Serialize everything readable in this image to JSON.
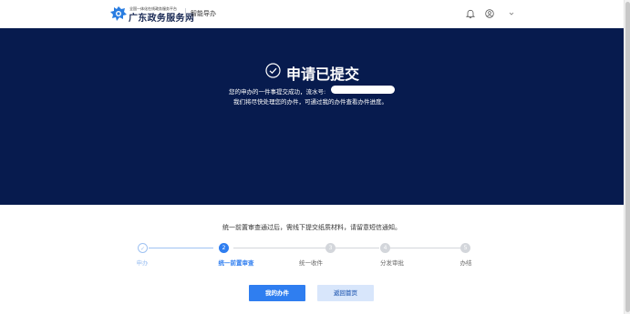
{
  "header": {
    "brand_sub": "全国一体化在线政务服务平台",
    "brand_main": "广东政务服务网",
    "module": "智能导办",
    "icons": [
      "bell-icon",
      "user-icon",
      "chevron-down-icon"
    ]
  },
  "hero": {
    "title": "申请已提交",
    "line1": "您的申办的一件事提交成功，流水号:",
    "line2": "我们将尽快处理您的办件，可通过我的办件查看办件进度。"
  },
  "notice": "统一前置审查通过后，需线下提交纸质材料，请留意短信通知。",
  "steps": [
    {
      "number": "✓",
      "label": "申办",
      "status": "done"
    },
    {
      "number": "2",
      "label": "统一前置审查",
      "status": "active"
    },
    {
      "number": "3",
      "label": "统一收件",
      "status": "pending"
    },
    {
      "number": "4",
      "label": "分发审批",
      "status": "pending"
    },
    {
      "number": "5",
      "label": "办结",
      "status": "pending"
    }
  ],
  "buttons": {
    "primary": "我的办件",
    "secondary": "返回首页"
  },
  "colors": {
    "hero_bg": "#071b4e",
    "primary": "#2f7ef0",
    "secondary_bg": "#d8e6fb",
    "step_done": "#9fc2f2",
    "step_pending": "#d3d6db"
  }
}
